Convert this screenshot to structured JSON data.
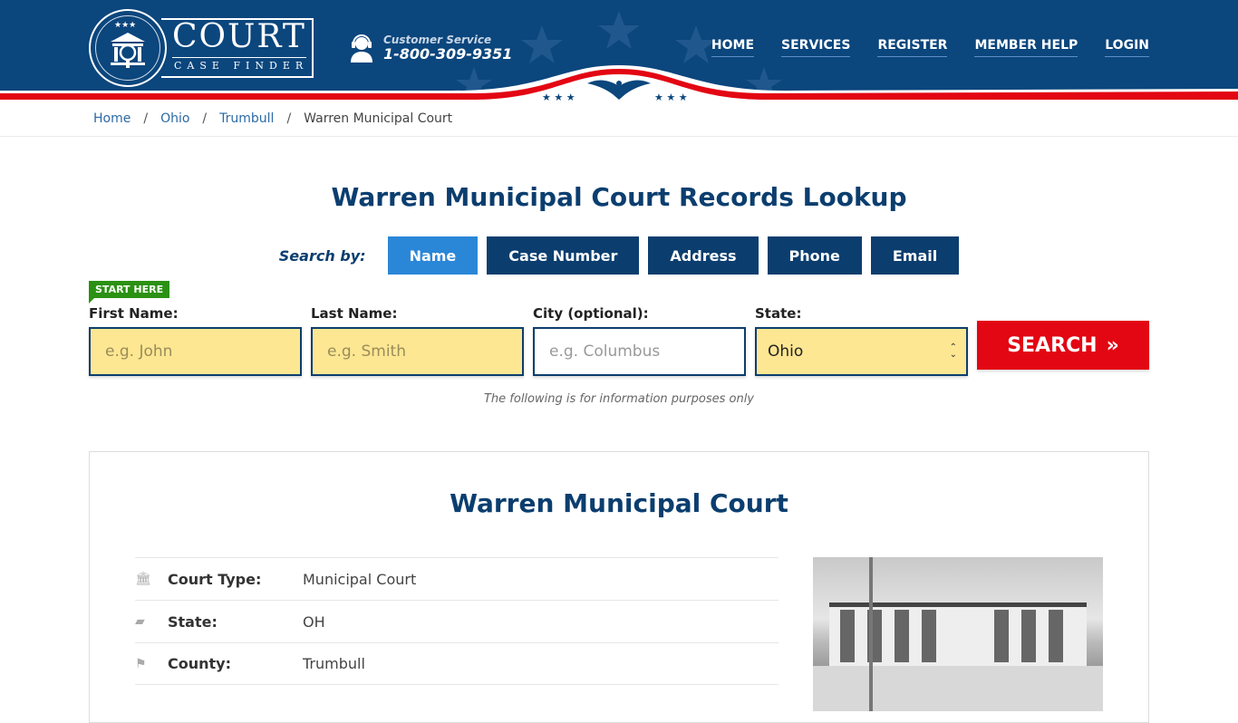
{
  "header": {
    "logo": {
      "title": "COURT",
      "subtitle": "CASE FINDER"
    },
    "customer_service": {
      "label": "Customer Service",
      "phone": "1-800-309-9351"
    },
    "nav": [
      {
        "label": "HOME"
      },
      {
        "label": "SERVICES"
      },
      {
        "label": "REGISTER"
      },
      {
        "label": "MEMBER HELP"
      },
      {
        "label": "LOGIN"
      }
    ]
  },
  "breadcrumb": [
    {
      "label": "Home"
    },
    {
      "label": "Ohio"
    },
    {
      "label": "Trumbull"
    },
    {
      "label": "Warren Municipal Court"
    }
  ],
  "page_title": "Warren Municipal Court Records Lookup",
  "search": {
    "search_by_label": "Search by:",
    "tabs": [
      {
        "label": "Name",
        "active": true
      },
      {
        "label": "Case Number"
      },
      {
        "label": "Address"
      },
      {
        "label": "Phone"
      },
      {
        "label": "Email"
      }
    ],
    "start_badge": "START HERE",
    "fields": {
      "first_name": {
        "label": "First Name:",
        "placeholder": "e.g. John"
      },
      "last_name": {
        "label": "Last Name:",
        "placeholder": "e.g. Smith"
      },
      "city": {
        "label": "City (optional):",
        "placeholder": "e.g.  Columbus"
      },
      "state": {
        "label": "State:",
        "value": "Ohio"
      }
    },
    "button_label": "SEARCH",
    "button_icon": "»",
    "disclaimer": "The following is for information purposes only"
  },
  "court": {
    "name": "Warren Municipal Court",
    "details": [
      {
        "icon": "courthouse-icon",
        "key": "Court Type:",
        "value": "Municipal Court"
      },
      {
        "icon": "usa-map-icon",
        "key": "State:",
        "value": "OH"
      },
      {
        "icon": "flag-icon",
        "key": "County:",
        "value": "Trumbull"
      }
    ]
  },
  "colors": {
    "brand_blue": "#0b467d",
    "heading_blue": "#0b3e6f",
    "active_tab": "#2a87d8",
    "search_red": "#e30613",
    "input_yellow": "#fde792",
    "start_green": "#2b9113"
  }
}
